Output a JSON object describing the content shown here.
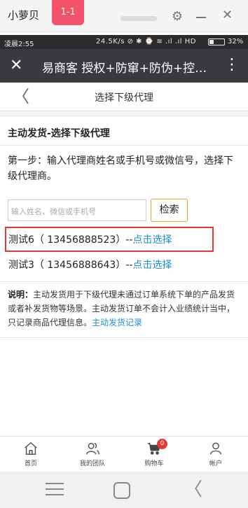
{
  "emulator": {
    "title": "小萝贝",
    "badge": "1-1"
  },
  "status_bar": {
    "time": "凌晨2:55",
    "indicators": "24.5K/s ⊘ ✱ ⌚ ≋ .ıl .ıl HD",
    "battery_level": 0.32,
    "battery_text": "32%"
  },
  "titlebar": {
    "title": "易商客 授权+防窜+防伪+控价...",
    "close_glyph": "✕",
    "more_glyph": "⋮"
  },
  "header": {
    "back_glyph": "〈",
    "title": "选择下级代理"
  },
  "main": {
    "section_title": "主动发货-选择下级代理",
    "step_text": "第一步：输入代理商姓名或手机号或微信号，选择下级代理商。",
    "search": {
      "placeholder": "输入姓名、微信或手机号",
      "button_label": "检索"
    },
    "agents": [
      {
        "name": "测试6（ 13456888523）--",
        "action": "点击选择"
      },
      {
        "name": "测试3（ 13456888643）--",
        "action": "点击选择"
      }
    ],
    "note": {
      "label": "说明：",
      "text": "主动发货用于下级代理未通过订单系统下单的产品发货或者补发货物等场景。主动发货订单不会计入业绩统计当中，只记录商品代理信息。",
      "link": "主动发货记录"
    }
  },
  "tabs": [
    {
      "label": "首页",
      "icon": "home-icon"
    },
    {
      "label": "我的团队",
      "icon": "team-icon"
    },
    {
      "label": "购物车",
      "icon": "cart-icon",
      "badge": "0"
    },
    {
      "label": "帐户",
      "icon": "account-icon"
    }
  ],
  "colors": {
    "titlebar": "#393a3f",
    "link": "#1a8fd1",
    "highlight": "#e53935",
    "search_button_border": "#e6a531",
    "emulator_badge": "#f2536a"
  }
}
